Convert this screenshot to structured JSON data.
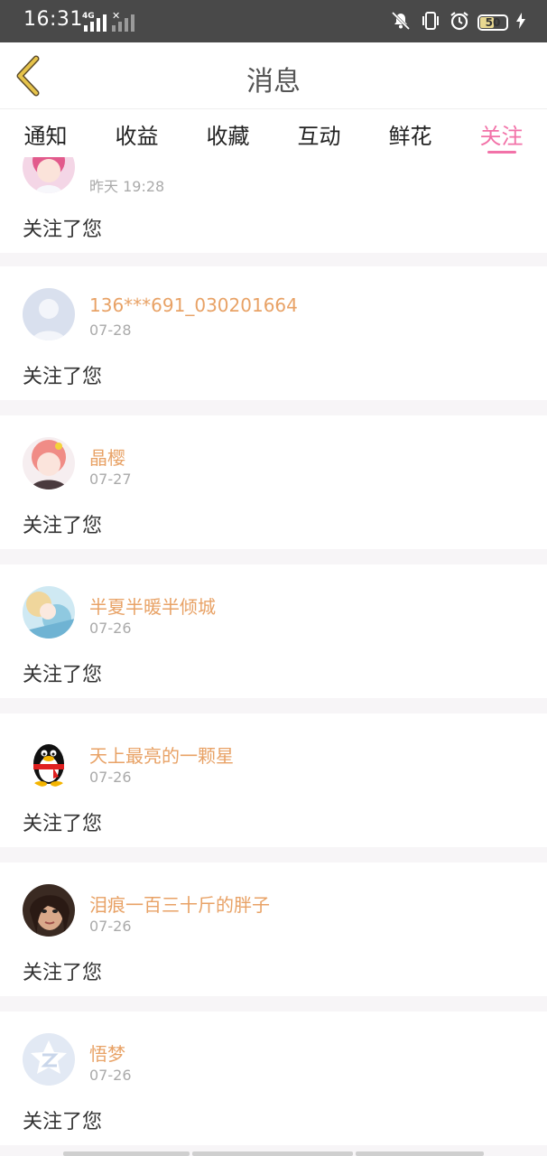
{
  "status_bar": {
    "time": "16:31",
    "net_label": "4G",
    "battery": "50",
    "icons": [
      "signal-icon",
      "no-sim-icon",
      "mute-icon",
      "vibrate-icon",
      "alarm-icon",
      "battery-icon",
      "charging-icon"
    ]
  },
  "header": {
    "title": "消息",
    "back_icon": "chevron-left-icon"
  },
  "tabs": [
    {
      "label": "通知",
      "active": false
    },
    {
      "label": "收益",
      "active": false
    },
    {
      "label": "收藏",
      "active": false
    },
    {
      "label": "互动",
      "active": false
    },
    {
      "label": "鲜花",
      "active": false
    },
    {
      "label": "关注",
      "active": true
    }
  ],
  "notifications": [
    {
      "name": "",
      "date": "昨天 19:28",
      "message": "关注了您",
      "avatar": "anime-pink-avatar"
    },
    {
      "name": "136***691_030201664",
      "date": "07-28",
      "message": "关注了您",
      "avatar": "default-user-avatar"
    },
    {
      "name": "晶樱",
      "date": "07-27",
      "message": "关注了您",
      "avatar": "anime-girl-avatar"
    },
    {
      "name": "半夏半暖半倾城",
      "date": "07-26",
      "message": "关注了您",
      "avatar": "anime-blue-avatar"
    },
    {
      "name": "天上最亮的一颗星",
      "date": "07-26",
      "message": "关注了您",
      "avatar": "penguin-avatar"
    },
    {
      "name": "泪痕一百三十斤的胖子",
      "date": "07-26",
      "message": "关注了您",
      "avatar": "photo-woman-avatar"
    },
    {
      "name": "悟梦",
      "date": "07-26",
      "message": "关注了您",
      "avatar": "zone-logo-avatar"
    }
  ],
  "colors": {
    "accent": "#f272a8",
    "username": "#e8a266",
    "back_arrow": "#e6c34a",
    "statusbar": "#494949"
  }
}
